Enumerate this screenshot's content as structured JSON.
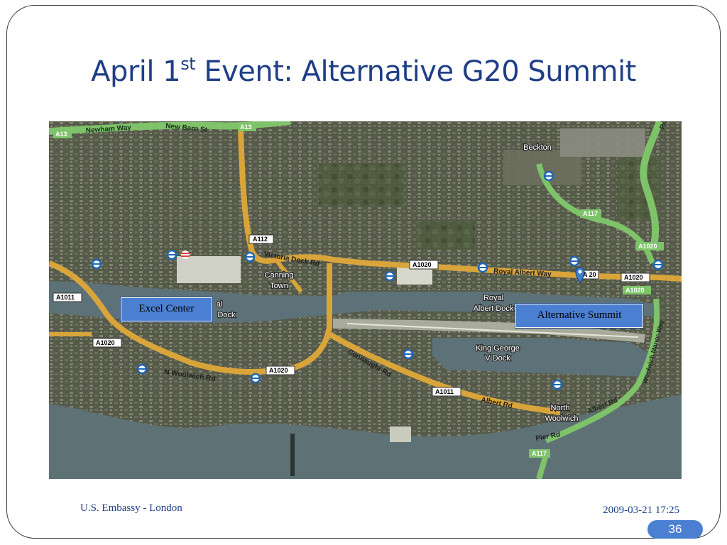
{
  "slide": {
    "title_prefix": "April 1",
    "title_sup": "st",
    "title_suffix": " Event: Alternative G20 Summit",
    "footer_left": "U.S. Embassy - London",
    "footer_right": "2009-03-21 17:25",
    "page_number": "36"
  },
  "map": {
    "callouts": {
      "excel": "Excel Center",
      "alt_summit": "Alternative Summit"
    },
    "roads": {
      "a13_a": "A13",
      "a13_b": "A13",
      "newham_way": "Newham Way",
      "new_barn_st": "New Barn St",
      "a112": "A112",
      "victoria_dock_rd": "Victoria Dock Rd",
      "a1020_top": "A1020",
      "royal_albert_way": "Royal Albert Way",
      "a1020_right1": "A1020",
      "a1020_right2": "A1020",
      "a1020_right3": "A1020",
      "a117_top": "A117",
      "a1011_left": "A1011",
      "a1020_left": "A1020",
      "n_woolwich_rd": "N Woolwich Rd",
      "a1020_mid": "A1020",
      "connaught_rd": "Connaught Rd",
      "a1011_mid": "A1011",
      "albert_rd": "Albert Rd",
      "albert_rd_right": "Albert Rd",
      "woolwich_manor_way": "Woolwich Manor Way",
      "pier_rd": "Pier Rd",
      "a117_bottom": "A117",
      "a20_marker": "A 20",
      "royal_edge": "Roy"
    },
    "places": {
      "beckton": "Beckton",
      "canning_town_1": "Canning",
      "canning_town_2": "Town",
      "royal_albert_dock_1": "Royal",
      "royal_albert_dock_2": "Albert Dock",
      "king_george_1": "King George",
      "king_george_2": "V Dock",
      "victoria_dock_1": "al",
      "victoria_dock_2": "Dock",
      "north_woolwich_1": "North",
      "north_woolwich_2": "Woolwich"
    },
    "colors": {
      "urban": "#5a5e4e",
      "water": "#5c7278",
      "road_major": "#d9a53a",
      "road_green": "#7ec36a",
      "title": "#1f3f86",
      "callout": "#4a7fd1"
    }
  }
}
